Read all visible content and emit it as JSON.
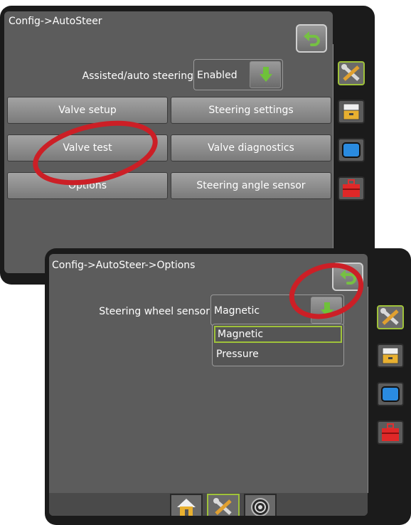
{
  "back_panel": {
    "breadcrumb": "Config->AutoSteer",
    "back_button": {
      "icon": "undo-arrow-icon"
    },
    "assisted_steering": {
      "label": "Assisted/auto steering",
      "value": "Enabled"
    },
    "buttons": {
      "valve_setup": "Valve setup",
      "steering_settings": "Steering settings",
      "valve_test": "Valve test",
      "valve_diagnostics": "Valve diagnostics",
      "options": "Options",
      "steering_angle_sensor": "Steering angle sensor"
    },
    "side_tabs": [
      "tools-icon",
      "display-icon",
      "monitor-icon",
      "toolbox-icon"
    ]
  },
  "front_panel": {
    "breadcrumb": "Config->AutoSteer->Options",
    "back_button": {
      "icon": "undo-arrow-icon"
    },
    "steering_wheel_sensor": {
      "label": "Steering wheel sensor",
      "value": "Magnetic",
      "options": [
        "Magnetic",
        "Pressure"
      ]
    },
    "side_tabs": [
      "tools-icon",
      "display-icon",
      "monitor-icon",
      "toolbox-icon"
    ],
    "bottom_tabs": [
      "home-icon",
      "tools-icon",
      "gps-icon"
    ]
  },
  "colors": {
    "highlight": "#cc1f26",
    "active_border": "#9fc23a",
    "arrow_green": "#6fc13a"
  }
}
